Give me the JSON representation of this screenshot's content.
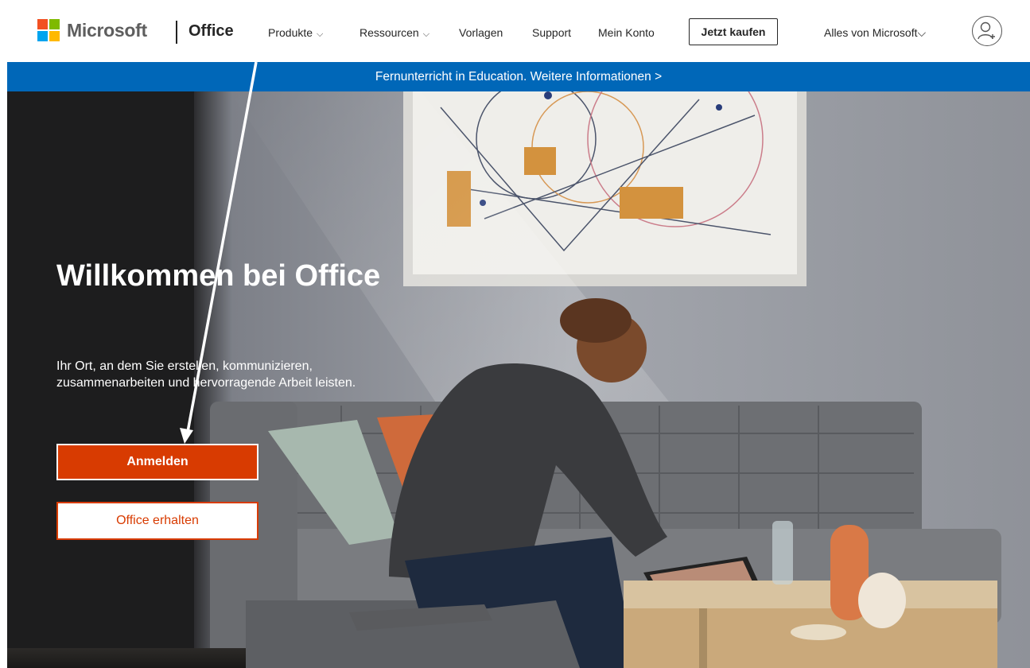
{
  "header": {
    "brand": "Microsoft",
    "product": "Office",
    "nav": [
      {
        "label": "Produkte",
        "has_dropdown": true
      },
      {
        "label": "Ressourcen",
        "has_dropdown": true
      },
      {
        "label": "Vorlagen",
        "has_dropdown": false
      },
      {
        "label": "Support",
        "has_dropdown": false
      },
      {
        "label": "Mein Konto",
        "has_dropdown": false
      }
    ],
    "buy_button": "Jetzt kaufen",
    "all_microsoft": "Alles von Microsoft",
    "dropdown_glyph": "⌵",
    "avatar_icon": "account-icon"
  },
  "banner": {
    "text": "Fernunterricht in Education. Weitere Informationen >"
  },
  "hero": {
    "title": "Willkommen bei Office",
    "subtitle": "Ihr Ort, an dem Sie erstellen, kommunizieren, zusammenarbeiten und hervorragende Arbeit leisten.",
    "primary_button": "Anmelden",
    "secondary_button": "Office erhalten"
  },
  "colors": {
    "banner": "#0067b8",
    "accent": "#d83b01",
    "logo_red": "#f25022",
    "logo_green": "#7fba00",
    "logo_blue": "#00a4ef",
    "logo_yellow": "#ffb900"
  }
}
